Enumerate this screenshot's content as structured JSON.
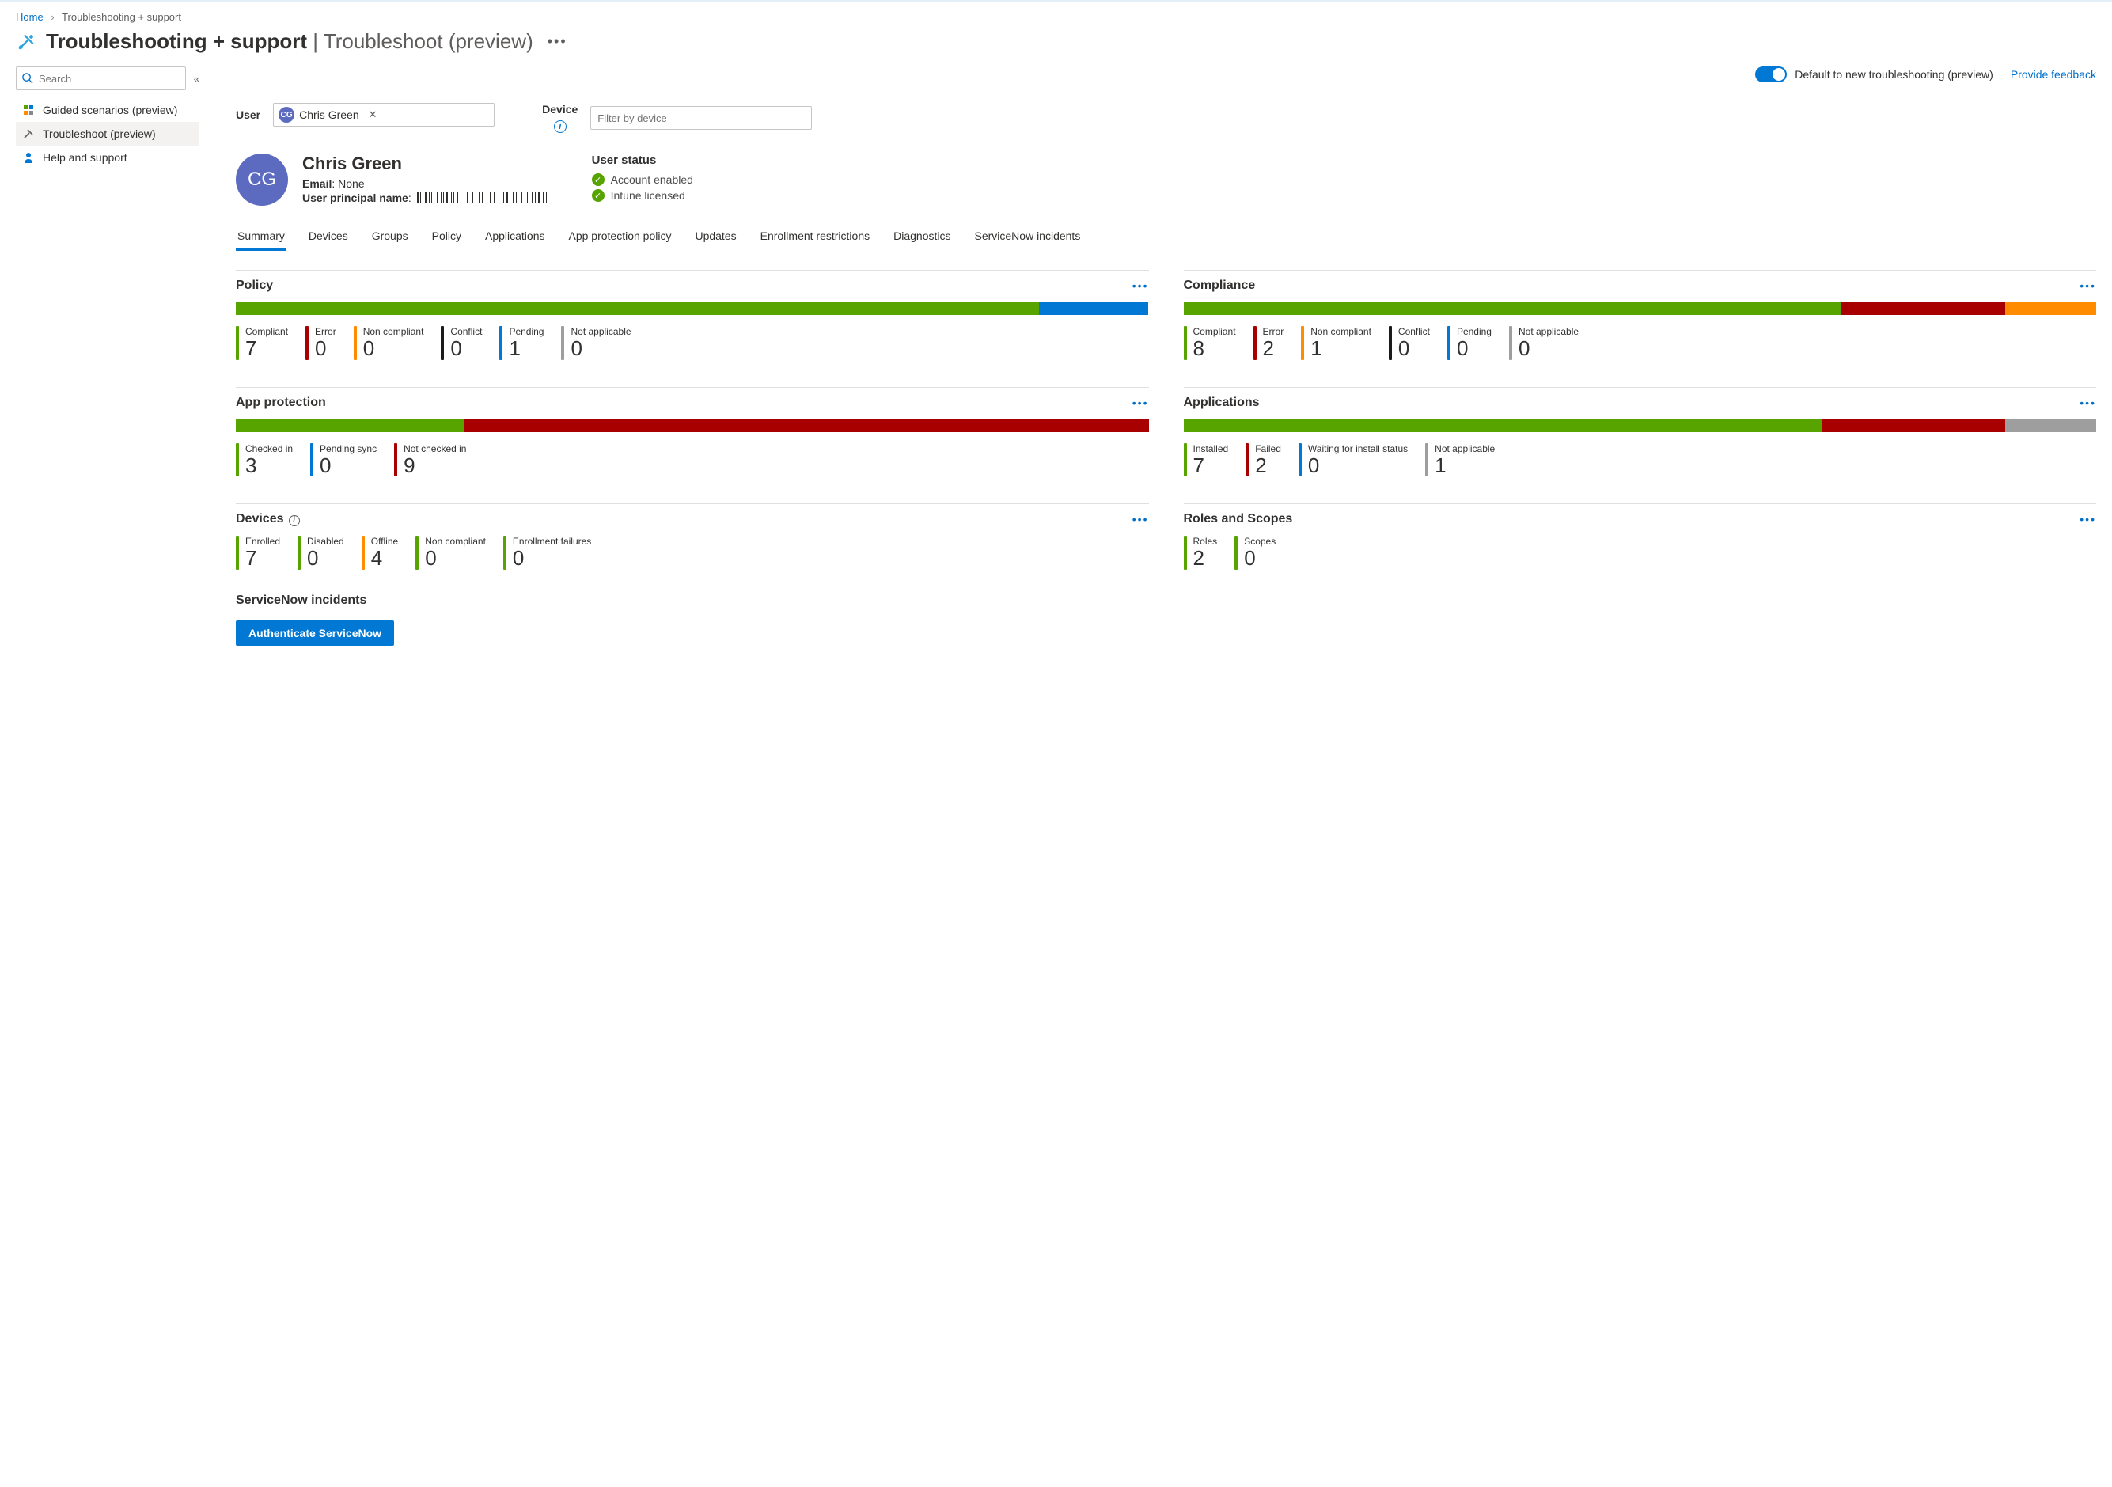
{
  "breadcrumb": {
    "home": "Home",
    "current": "Troubleshooting + support"
  },
  "page_title": {
    "main": "Troubleshooting + support",
    "sub": "Troubleshoot (preview)"
  },
  "sidebar": {
    "search_placeholder": "Search",
    "items": [
      {
        "label": "Guided scenarios (preview)"
      },
      {
        "label": "Troubleshoot (preview)"
      },
      {
        "label": "Help and support"
      }
    ]
  },
  "topbar": {
    "toggle_label": "Default to new troubleshooting (preview)",
    "feedback": "Provide feedback"
  },
  "filters": {
    "user_label": "User",
    "user_value": "Chris Green",
    "user_initials": "CG",
    "device_label": "Device",
    "device_placeholder": "Filter by device"
  },
  "user": {
    "initials": "CG",
    "name": "Chris Green",
    "email_label": "Email",
    "email_value": "None",
    "upn_label": "User principal name"
  },
  "user_status": {
    "title": "User status",
    "items": [
      "Account enabled",
      "Intune licensed"
    ]
  },
  "tabs": [
    "Summary",
    "Devices",
    "Groups",
    "Policy",
    "Applications",
    "App protection policy",
    "Updates",
    "Enrollment restrictions",
    "Diagnostics",
    "ServiceNow incidents"
  ],
  "colors": {
    "green": "#57a300",
    "red": "#a80000",
    "orange": "#ff8c00",
    "blue": "#0078d4",
    "grey": "#9e9e9e",
    "black": "#1b1b1b"
  },
  "cards": {
    "policy": {
      "title": "Policy",
      "segments": [
        {
          "color": "green",
          "w": 88
        },
        {
          "color": "blue",
          "w": 12
        }
      ],
      "metrics": [
        {
          "label": "Compliant",
          "value": "7",
          "color": "green"
        },
        {
          "label": "Error",
          "value": "0",
          "color": "red"
        },
        {
          "label": "Non compliant",
          "value": "0",
          "color": "orange"
        },
        {
          "label": "Conflict",
          "value": "0",
          "color": "black"
        },
        {
          "label": "Pending",
          "value": "1",
          "color": "blue"
        },
        {
          "label": "Not applicable",
          "value": "0",
          "color": "grey"
        }
      ]
    },
    "compliance": {
      "title": "Compliance",
      "segments": [
        {
          "color": "green",
          "w": 72
        },
        {
          "color": "red",
          "w": 18
        },
        {
          "color": "orange",
          "w": 10
        }
      ],
      "metrics": [
        {
          "label": "Compliant",
          "value": "8",
          "color": "green"
        },
        {
          "label": "Error",
          "value": "2",
          "color": "red"
        },
        {
          "label": "Non compliant",
          "value": "1",
          "color": "orange"
        },
        {
          "label": "Conflict",
          "value": "0",
          "color": "black"
        },
        {
          "label": "Pending",
          "value": "0",
          "color": "blue"
        },
        {
          "label": "Not applicable",
          "value": "0",
          "color": "grey"
        }
      ]
    },
    "appprotection": {
      "title": "App protection",
      "segments": [
        {
          "color": "green",
          "w": 25
        },
        {
          "color": "red",
          "w": 75
        }
      ],
      "metrics": [
        {
          "label": "Checked in",
          "value": "3",
          "color": "green"
        },
        {
          "label": "Pending sync",
          "value": "0",
          "color": "blue"
        },
        {
          "label": "Not checked in",
          "value": "9",
          "color": "red"
        }
      ]
    },
    "applications": {
      "title": "Applications",
      "segments": [
        {
          "color": "green",
          "w": 70
        },
        {
          "color": "red",
          "w": 20
        },
        {
          "color": "grey",
          "w": 10
        }
      ],
      "metrics": [
        {
          "label": "Installed",
          "value": "7",
          "color": "green"
        },
        {
          "label": "Failed",
          "value": "2",
          "color": "red"
        },
        {
          "label": "Waiting for install status",
          "value": "0",
          "color": "blue"
        },
        {
          "label": "Not applicable",
          "value": "1",
          "color": "grey"
        }
      ]
    },
    "devices": {
      "title": "Devices",
      "info": true,
      "metrics": [
        {
          "label": "Enrolled",
          "value": "7",
          "color": "green"
        },
        {
          "label": "Disabled",
          "value": "0",
          "color": "green"
        },
        {
          "label": "Offline",
          "value": "4",
          "color": "orange"
        },
        {
          "label": "Non compliant",
          "value": "0",
          "color": "green"
        },
        {
          "label": "Enrollment failures",
          "value": "0",
          "color": "green"
        }
      ]
    },
    "roles": {
      "title": "Roles and Scopes",
      "metrics": [
        {
          "label": "Roles",
          "value": "2",
          "color": "green"
        },
        {
          "label": "Scopes",
          "value": "0",
          "color": "green"
        }
      ]
    }
  },
  "servicenow": {
    "title": "ServiceNow incidents",
    "button": "Authenticate ServiceNow"
  }
}
